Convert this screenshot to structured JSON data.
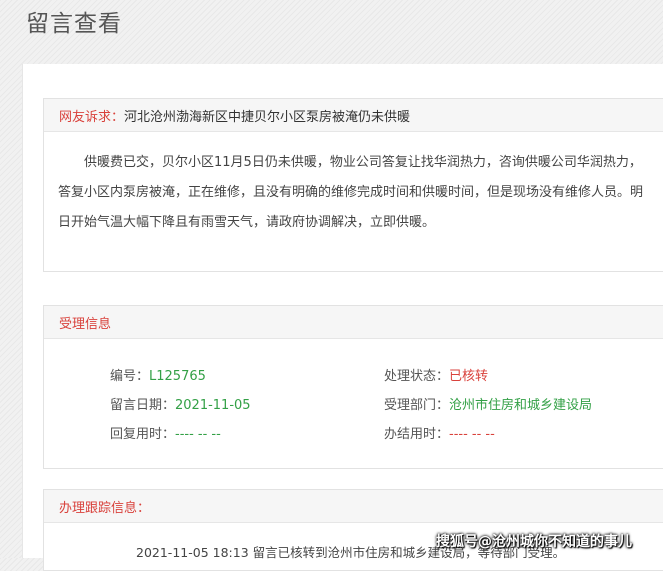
{
  "page": {
    "title": "留言查看"
  },
  "complaint": {
    "label": "网友诉求：",
    "title": "河北沧州渤海新区中捷贝尔小区泵房被淹仍未供暖",
    "body": "供暖费已交，贝尔小区11月5日仍未供暖，物业公司答复让找华润热力，咨询供暖公司华润热力，答复小区内泵房被淹，正在维修，且没有明确的维修完成时间和供暖时间，但是现场没有维修人员。明日开始气温大幅下降且有雨雪天气，请政府协调解决，立即供暖。"
  },
  "acceptance": {
    "label": "受理信息",
    "number_label": "编号：",
    "number": "L125765",
    "status_label": "处理状态：",
    "status": "已核转",
    "date_label": "留言日期：",
    "date": "2021-11-05",
    "dept_label": "受理部门：",
    "dept": "沧州市住房和城乡建设局",
    "reply_label": "回复用时：",
    "reply_time": "---- -- --",
    "done_label": "办结用时：",
    "done_time": "---- -- --"
  },
  "tracking": {
    "label": "办理跟踪信息：",
    "items": [
      {
        "time": "2021-11-05 18:13",
        "text": "留言已核转到沧州市住房和城乡建设局，等待部门受理。"
      }
    ]
  },
  "watermark": "搜狐号@沧州城你不知道的事儿",
  "colors": {
    "accent": "#d9423c",
    "value_green": "#33a046"
  }
}
